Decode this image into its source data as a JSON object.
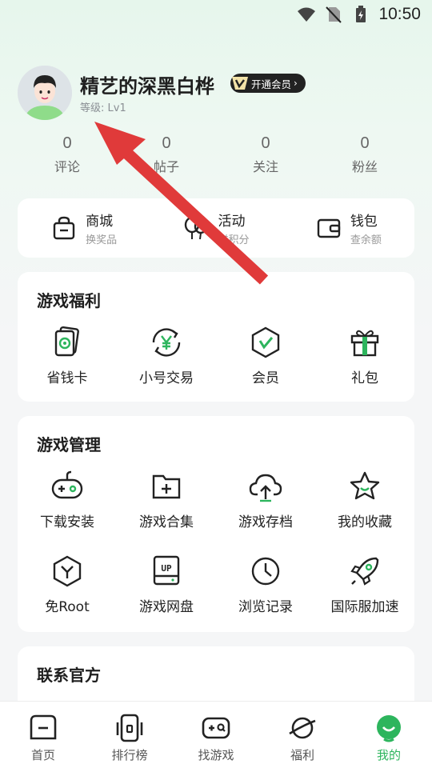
{
  "status_bar": {
    "time": "10:50"
  },
  "profile": {
    "username": "精艺的深黑白桦",
    "vip_label": "开通会员",
    "level": "等级: Lv1"
  },
  "stats": [
    {
      "value": "0",
      "label": "评论"
    },
    {
      "value": "0",
      "label": "帖子"
    },
    {
      "value": "0",
      "label": "关注"
    },
    {
      "value": "0",
      "label": "粉丝"
    }
  ],
  "shop": [
    {
      "title": "商城",
      "subtitle": "换奖品",
      "icon": "bag-icon"
    },
    {
      "title": "活动",
      "subtitle": "赚积分",
      "icon": "balloon-icon"
    },
    {
      "title": "钱包",
      "subtitle": "查余额",
      "icon": "wallet-icon"
    }
  ],
  "benefits": {
    "title": "游戏福利",
    "items": [
      {
        "label": "省钱卡",
        "icon": "card-icon"
      },
      {
        "label": "小号交易",
        "icon": "yen-exchange-icon"
      },
      {
        "label": "会员",
        "icon": "vip-shield-icon"
      },
      {
        "label": "礼包",
        "icon": "gift-icon"
      }
    ]
  },
  "management": {
    "title": "游戏管理",
    "items": [
      {
        "label": "下载安装",
        "icon": "gamepad-icon"
      },
      {
        "label": "游戏合集",
        "icon": "folder-plus-icon"
      },
      {
        "label": "游戏存档",
        "icon": "cloud-upload-icon"
      },
      {
        "label": "我的收藏",
        "icon": "star-icon"
      },
      {
        "label": "免Root",
        "icon": "hexagon-y-icon"
      },
      {
        "label": "游戏网盘",
        "icon": "up-drive-icon"
      },
      {
        "label": "浏览记录",
        "icon": "clock-icon"
      },
      {
        "label": "国际服加速",
        "icon": "rocket-icon"
      }
    ]
  },
  "contact": {
    "title": "联系官方"
  },
  "bottom_nav": [
    {
      "label": "首页",
      "icon": "home-icon"
    },
    {
      "label": "排行榜",
      "icon": "ranking-icon"
    },
    {
      "label": "找游戏",
      "icon": "find-game-icon"
    },
    {
      "label": "福利",
      "icon": "planet-icon"
    },
    {
      "label": "我的",
      "icon": "profile-face-icon"
    }
  ],
  "colors": {
    "accent": "#2db55d",
    "arrow": "#e03a3a"
  }
}
